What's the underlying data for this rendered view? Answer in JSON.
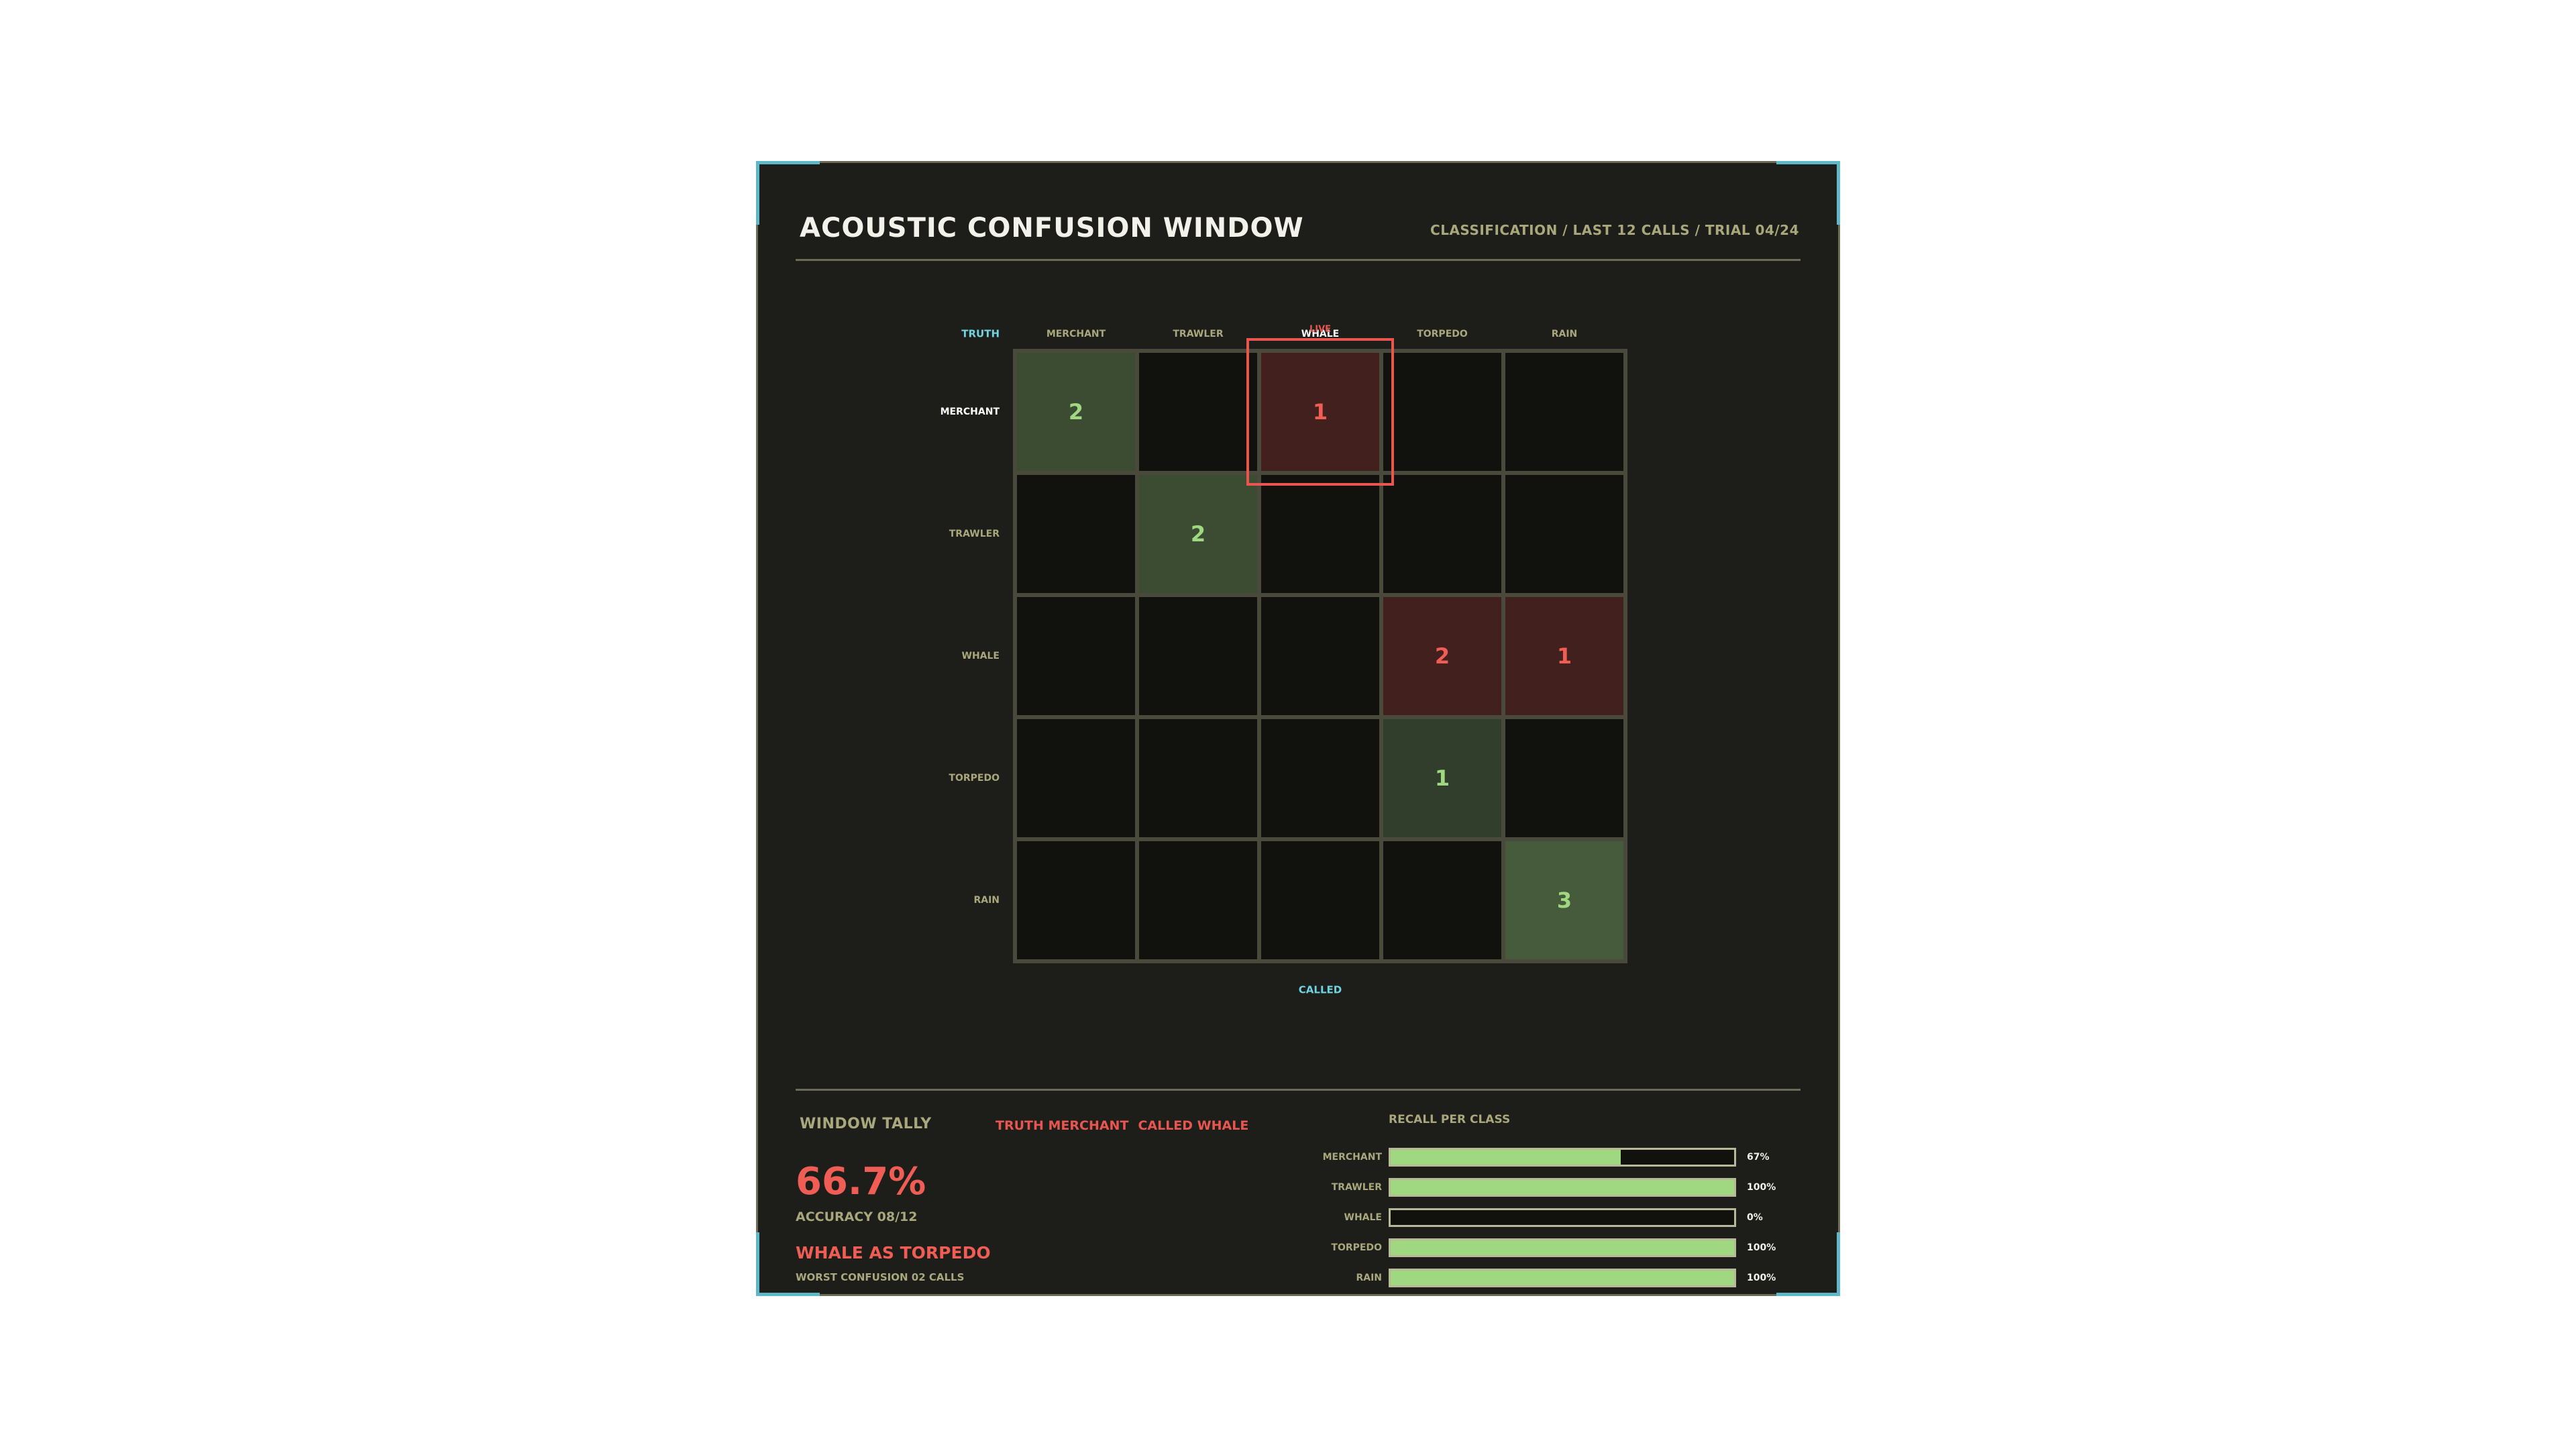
{
  "header": {
    "title": "ACOUSTIC CONFUSION WINDOW",
    "subtitle": "CLASSIFICATION / LAST 12 CALLS / TRIAL 04/24"
  },
  "chart_data": {
    "type": "heatmap",
    "y_axis_label": "TRUTH",
    "x_axis_label": "CALLED",
    "categories": [
      "MERCHANT",
      "TRAWLER",
      "WHALE",
      "TORPEDO",
      "RAIN"
    ],
    "matrix": [
      [
        2,
        0,
        1,
        0,
        0
      ],
      [
        0,
        2,
        0,
        0,
        0
      ],
      [
        0,
        0,
        0,
        2,
        1
      ],
      [
        0,
        0,
        0,
        1,
        0
      ],
      [
        0,
        0,
        0,
        0,
        3
      ]
    ],
    "live_marker": {
      "label": "LIVE",
      "row": 0,
      "col": 2
    },
    "colors": {
      "empty": "#11110e",
      "correct": "#465a3c",
      "error": "#42201d",
      "correct_text": "#9fd880",
      "error_text": "#ef5d55",
      "cell_border": "#4a4a3c",
      "highlight": "#e9564f",
      "axis_accent": "#6fd3e0"
    }
  },
  "tally": {
    "label": "WINDOW TALLY",
    "focus_truth": "TRUTH MERCHANT",
    "focus_called": "CALLED WHALE",
    "accuracy": "66.7%",
    "accuracy_label": "ACCURACY 08/12",
    "worst": "WHALE AS TORPEDO",
    "worst_label": "WORST CONFUSION 02 CALLS"
  },
  "recall": {
    "title": "RECALL PER CLASS",
    "items": [
      {
        "label": "MERCHANT",
        "value": 0.67,
        "display": "67%"
      },
      {
        "label": "TRAWLER",
        "value": 1.0,
        "display": "100%"
      },
      {
        "label": "WHALE",
        "value": 0.0,
        "display": "0%"
      },
      {
        "label": "TORPEDO",
        "value": 1.0,
        "display": "100%"
      },
      {
        "label": "RAIN",
        "value": 1.0,
        "display": "100%"
      }
    ]
  }
}
